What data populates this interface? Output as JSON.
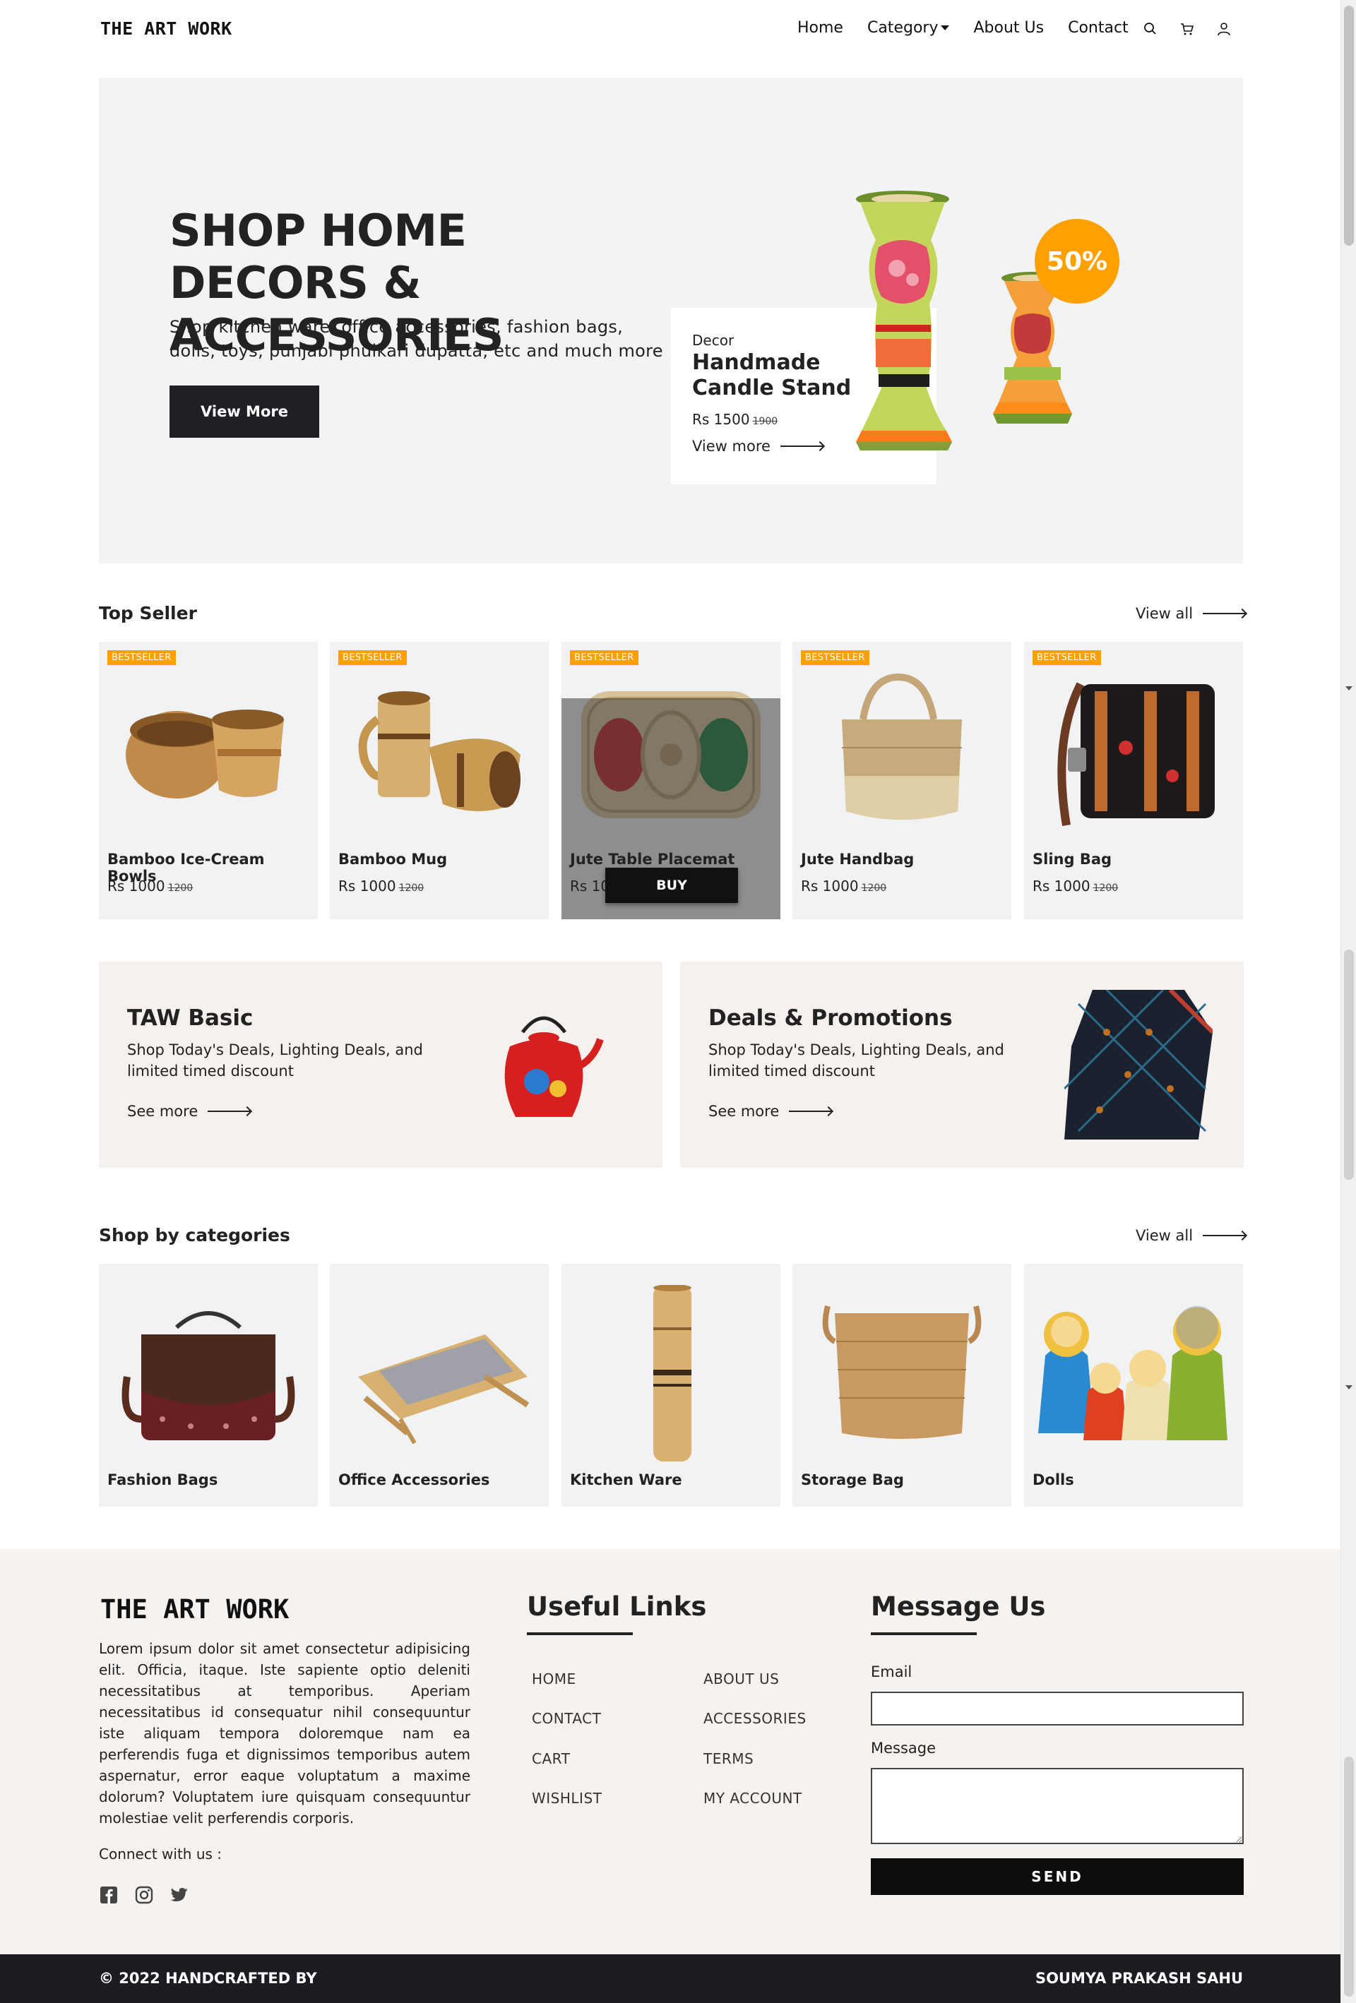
{
  "brand": {
    "logo_text": "THE ART WORK"
  },
  "nav": {
    "links": [
      "Home",
      "Category",
      "About Us",
      "Contact"
    ],
    "icons": [
      "search-icon",
      "cart-icon",
      "user-icon"
    ]
  },
  "hero": {
    "title": "SHOP HOME DECORS & ACCESSORIES",
    "subtitle": "Shop kitchen ware, office accessories, fashion bags, dolls, toys, punjabi phulkari dupatta, etc and much more",
    "button_label": "View More",
    "featured": {
      "category": "Decor",
      "name": "Handmade Candle Stand",
      "price": "Rs 1500",
      "old_price": "1900",
      "link_label": "View more"
    },
    "discount_badge": "50%"
  },
  "top_seller": {
    "title": "Top Seller",
    "view_all": "View all",
    "badge": "BESTSELLER",
    "buy_label": "BUY",
    "products": [
      {
        "name": "Bamboo Ice-Cream Bowls",
        "price": "Rs 1000",
        "old_price": "1200"
      },
      {
        "name": "Bamboo Mug",
        "price": "Rs 1000",
        "old_price": "1200"
      },
      {
        "name": "Jute Table Placemat",
        "price": "Rs 1000",
        "old_price": "1200"
      },
      {
        "name": "Jute Handbag",
        "price": "Rs 1000",
        "old_price": "1200"
      },
      {
        "name": "Sling Bag",
        "price": "Rs 1000",
        "old_price": "1200"
      }
    ]
  },
  "promos": [
    {
      "title": "TAW Basic",
      "text": "Shop Today's Deals, Lighting Deals, and limited timed discount",
      "link_label": "See more"
    },
    {
      "title": "Deals & Promotions",
      "text": "Shop Today's Deals, Lighting Deals, and limited timed discount",
      "link_label": "See more"
    }
  ],
  "categories": {
    "title": "Shop by categories",
    "view_all": "View all",
    "items": [
      "Fashion Bags",
      "Office Accessories",
      "Kitchen Ware",
      "Storage Bag",
      "Dolls"
    ]
  },
  "footer": {
    "logo_text": "THE ART WORK",
    "about": "Lorem ipsum dolor sit amet consectetur adipisicing elit. Officia, itaque. Iste sapiente optio deleniti necessitatibus at temporibus. Aperiam necessitatibus id consequatur nihil consequuntur iste aliquam tempora doloremque nam ea perferendis fuga et dignissimos temporibus autem aspernatur, error eaque voluptatum a maxime dolorum? Voluptatem iure quisquam consequuntur molestiae velit perferendis corporis.",
    "connect_label": "Connect with us :",
    "social_icons": [
      "facebook-icon",
      "instagram-icon",
      "twitter-icon"
    ],
    "links_title": "Useful Links",
    "links_col1": [
      "HOME",
      "CONTACT",
      "CART",
      "WISHLIST"
    ],
    "links_col2": [
      "ABOUT US",
      "ACCESSORIES",
      "TERMS",
      "MY ACCOUNT"
    ],
    "message_title": "Message Us",
    "email_label": "Email",
    "email_value": "",
    "message_label": "Message",
    "message_value": "",
    "send_label": "SEND"
  },
  "bottom_bar": {
    "left": "© 2022 HANDCRAFTED BY",
    "right": "SOUMYA PRAKASH SAHU"
  },
  "colors": {
    "accent": "#ffa000",
    "dark": "#1e2026",
    "card_bg": "#f0f2f4",
    "footer_bg": "#f6f2ef"
  }
}
